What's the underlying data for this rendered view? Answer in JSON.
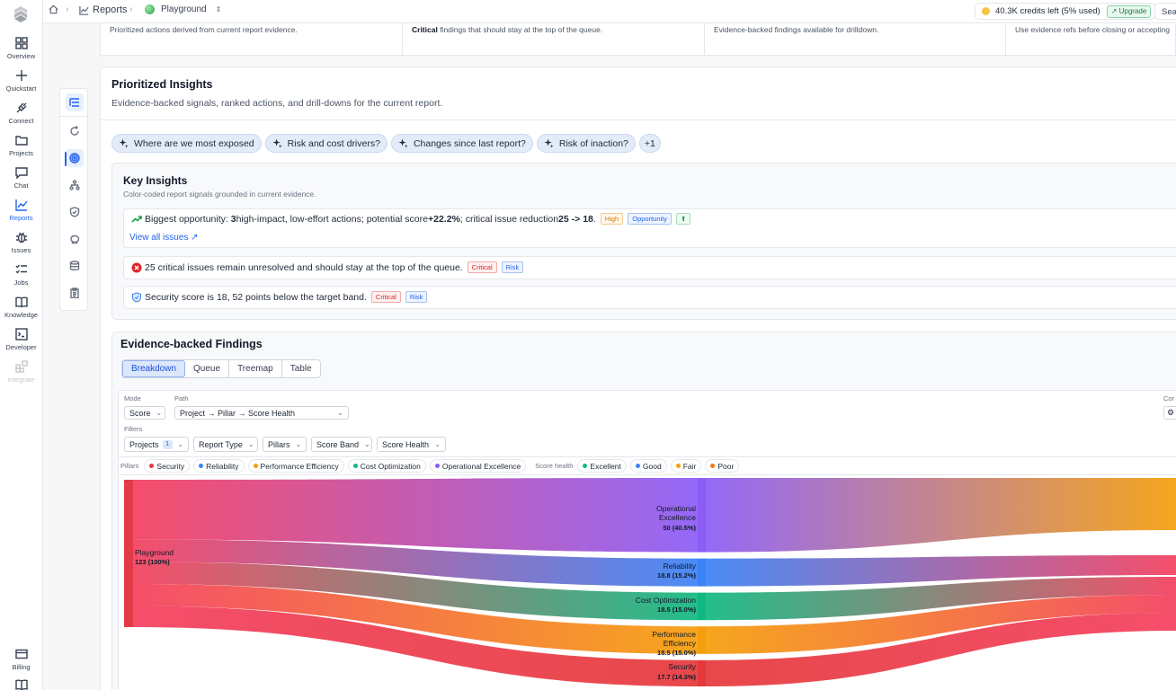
{
  "breadcrumb": {
    "section": "Reports",
    "project": "Playground"
  },
  "credits": {
    "text": "40.3K credits left (5% used)",
    "upgrade_label": "↗ Upgrade",
    "search_label": "Search"
  },
  "rail": {
    "items": [
      {
        "label": "Overview"
      },
      {
        "label": "Quickstart"
      },
      {
        "label": "Connect"
      },
      {
        "label": "Projects"
      },
      {
        "label": "Chat"
      },
      {
        "label": "Reports"
      },
      {
        "label": "Issues"
      },
      {
        "label": "Jobs"
      },
      {
        "label": "Knowledge"
      },
      {
        "label": "Developer"
      },
      {
        "label": "Integrate"
      }
    ],
    "billing_label": "Billing"
  },
  "summary": {
    "cells": [
      {
        "text": "Prioritized actions derived from current report evidence."
      },
      {
        "bold": "Critical",
        "text": " findings that should stay at the top of the queue."
      },
      {
        "text": "Evidence-backed findings available for drilldown."
      },
      {
        "text": "Use evidence refs before closing or accepting"
      }
    ]
  },
  "panel": {
    "title": "Prioritized Insights",
    "subtitle": "Evidence-backed signals, ranked actions, and drill-downs for the current report."
  },
  "chips": [
    {
      "label": "Where are we most exposed"
    },
    {
      "label": "Risk and cost drivers?"
    },
    {
      "label": "Changes since last report?"
    },
    {
      "label": "Risk of inaction?"
    },
    {
      "label": "+1"
    }
  ],
  "key_insights": {
    "title": "Key Insights",
    "subtitle": "Color-coded report signals grounded in current evidence.",
    "rows": [
      {
        "p1": "Biggest opportunity: ",
        "b1": "3",
        "p2": " high-impact, low-effort actions; potential score ",
        "b2": "+22.2%",
        "p3": "; critical issue reduction ",
        "b3": "25 -> 18",
        "p4": ".",
        "tags": [
          "High",
          "Opportunity",
          "⬆"
        ],
        "link": "View all issues ↗"
      },
      {
        "text": "25 critical issues remain unresolved and should stay at the top of the queue.",
        "tags": [
          "Critical",
          "Risk"
        ]
      },
      {
        "text": "Security score is 18, 52 points below the target band.",
        "tags": [
          "Critical",
          "Risk"
        ]
      }
    ]
  },
  "findings": {
    "title": "Evidence-backed Findings",
    "tabs": [
      "Breakdown",
      "Queue",
      "Treemap",
      "Table"
    ],
    "active_tab": "Breakdown",
    "mode_label": "Mode",
    "mode_value": "Score",
    "path_label": "Path",
    "path_value": "Project → Pillar → Score Health",
    "cor_label": "Cor",
    "filters_label": "Filters",
    "filters": [
      {
        "label": "Projects",
        "badge": "1"
      },
      {
        "label": "Report Type"
      },
      {
        "label": "Pillars"
      },
      {
        "label": "Score Band"
      },
      {
        "label": "Score Health"
      }
    ],
    "legend": {
      "pillars_label": "Pillars",
      "pillars": [
        {
          "name": "Security",
          "color": "#e5383b"
        },
        {
          "name": "Reliability",
          "color": "#3b82f6"
        },
        {
          "name": "Performance Efficiency",
          "color": "#f59e0b"
        },
        {
          "name": "Cost Optimization",
          "color": "#10b981"
        },
        {
          "name": "Operational Excellence",
          "color": "#8b5cf6"
        }
      ],
      "health_label": "Score health",
      "health": [
        {
          "name": "Excellent",
          "color": "#10b981"
        },
        {
          "name": "Good",
          "color": "#3b82f6"
        },
        {
          "name": "Fair",
          "color": "#f59e0b"
        },
        {
          "name": "Poor",
          "color": "#f97316"
        }
      ]
    },
    "sankey": {
      "root": {
        "name": "Playground",
        "value": "123 (100%)"
      },
      "nodes": [
        {
          "name": "Operational Excellence",
          "value": "50 (40.5%)",
          "share": 40.5,
          "color": "#8b5cf6"
        },
        {
          "name": "Reliability",
          "value": "18.8 (15.2%)",
          "share": 15.2,
          "color": "#3b82f6"
        },
        {
          "name": "Cost Optimization",
          "value": "18.5 (15.0%)",
          "share": 15.0,
          "color": "#10b981"
        },
        {
          "name": "Performance Efficiency",
          "value": "18.5 (15.0%)",
          "share": 15.0,
          "color": "#f59e0b"
        },
        {
          "name": "Security",
          "value": "17.7 (14.3%)",
          "share": 14.3,
          "color": "#e5383b"
        }
      ]
    }
  }
}
